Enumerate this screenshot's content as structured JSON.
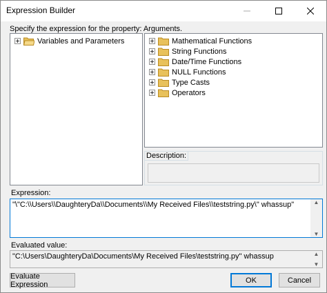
{
  "window": {
    "title": "Expression Builder"
  },
  "prompt": "Specify the expression for the property: Arguments.",
  "left_tree": {
    "items": [
      {
        "label": "Variables and Parameters"
      }
    ]
  },
  "right_tree": {
    "items": [
      {
        "label": "Mathematical Functions"
      },
      {
        "label": "String Functions"
      },
      {
        "label": "Date/Time Functions"
      },
      {
        "label": "NULL Functions"
      },
      {
        "label": "Type Casts"
      },
      {
        "label": "Operators"
      }
    ]
  },
  "description": {
    "label": "Description:",
    "value": ""
  },
  "expression": {
    "label": "Expression:",
    "value": "\"\\\"C:\\\\Users\\\\DaughteryDa\\\\Documents\\\\My Received Files\\\\teststring.py\\\"  whassup\""
  },
  "evaluated": {
    "label": "Evaluated value:",
    "value": "\"C:\\Users\\DaughteryDa\\Documents\\My Received Files\\teststring.py\"  whassup"
  },
  "buttons": {
    "evaluate": "Evaluate Expression",
    "ok": "OK",
    "cancel": "Cancel"
  },
  "colors": {
    "accent": "#0078d7",
    "folder": "#e8c15b",
    "dialog_bg": "#f0f0f0"
  }
}
